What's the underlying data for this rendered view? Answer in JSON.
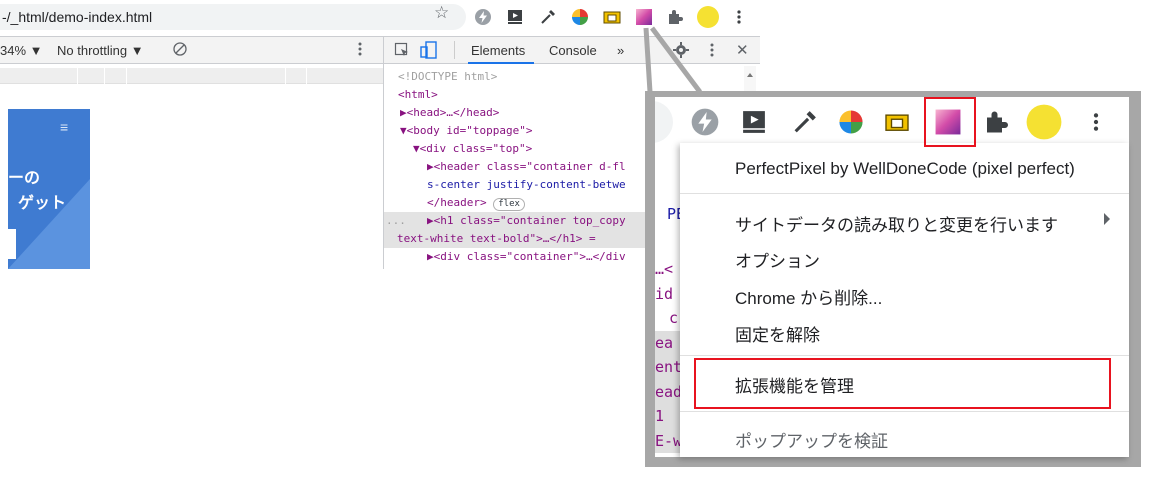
{
  "browser": {
    "url": "-/_html/demo-index.html",
    "star_icon": "star-icon"
  },
  "devtools": {
    "left_toolbar": {
      "zoom": "34% ▼",
      "throttling": "No throttling ▼"
    },
    "tabs": {
      "elements": "Elements",
      "console": "Console",
      "more": "»"
    },
    "code_lines": [
      {
        "text": "<!DOCTYPE html>"
      },
      {
        "text": "<html>"
      },
      {
        "text": "▶<head>…</head>"
      },
      {
        "text": "▼<body id=\"toppage\">"
      },
      {
        "text": "▼<div class=\"top\">"
      },
      {
        "text": "▶<header class=\"container d-fl"
      },
      {
        "text": "s-center justify-content-betwe"
      },
      {
        "text": "</header>"
      },
      {
        "text": "▶<h1 class=\"container top_copy"
      },
      {
        "text": "text-white text-bold\">…</h1> ="
      },
      {
        "text": "▶<div class=\"container\">…</div"
      }
    ],
    "flex_badge": "flex",
    "row_marker": "...",
    "page_preview": {
      "line1": "ーの",
      "line2": "ゲット",
      "menu_icon": "≡"
    }
  },
  "extension_menu": {
    "title": "PerfectPixel by WellDoneCode (pixel perfect)",
    "items": [
      {
        "label": "サイトデータの読み取りと変更を行います",
        "has_submenu": true
      },
      {
        "label": "オプション"
      },
      {
        "label": "Chrome から削除..."
      },
      {
        "label": "固定を解除"
      },
      {
        "label": "拡張機能を管理"
      },
      {
        "label": "ポップアップを検証"
      }
    ],
    "background_code": [
      "…<",
      "id",
      "c",
      "ea",
      "ent",
      "ead",
      "1",
      "E-w"
    ],
    "background_tab_fragment": "PE"
  },
  "colors": {
    "highlight": "#e8131f",
    "popup_frame": "#a7a7a7",
    "profile_avatar": "#f5e132",
    "page_blue": "#3f7bd1"
  },
  "icons": [
    "lightning-icon",
    "video-icon",
    "eyedropper-icon",
    "color-wheel-icon",
    "folder-icon",
    "perfectpixel-icon",
    "puzzle-icon",
    "avatar",
    "kebab-icon"
  ]
}
